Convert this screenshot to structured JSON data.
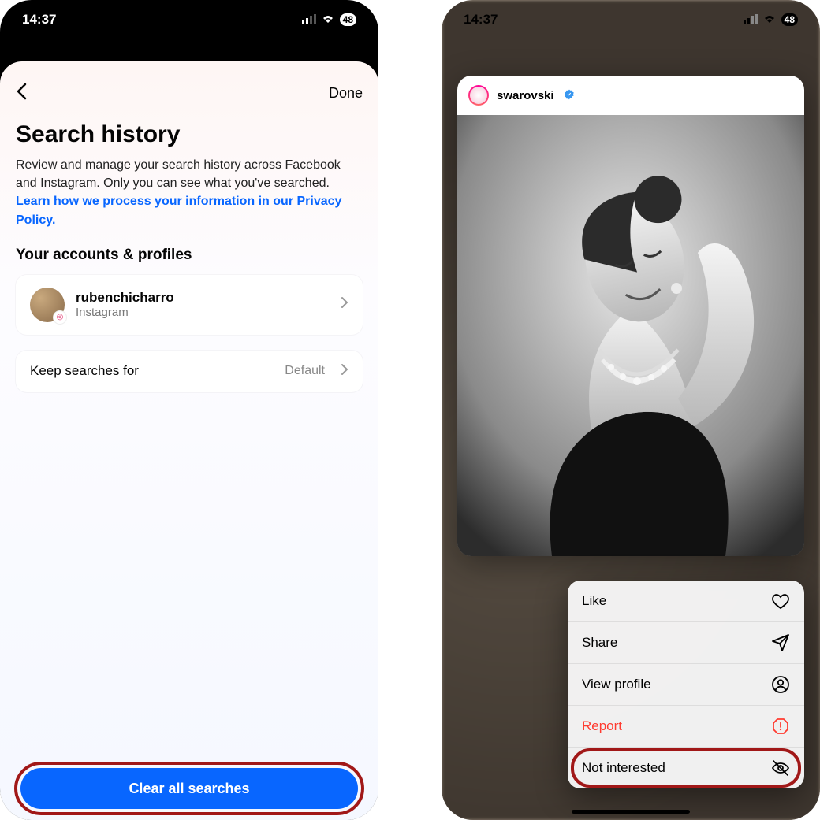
{
  "status": {
    "time": "14:37",
    "battery": "48"
  },
  "left": {
    "done": "Done",
    "title": "Search history",
    "desc_prefix": "Review and manage your search history across Facebook and Instagram. Only you can see what you've searched. ",
    "desc_link": "Learn how we process your information in our Privacy Policy.",
    "section": "Your accounts & profiles",
    "account": {
      "name": "rubenchicharro",
      "platform": "Instagram"
    },
    "keep_label": "Keep searches for",
    "keep_value": "Default",
    "clear": "Clear all searches"
  },
  "right": {
    "post_user": "swarovski",
    "menu": {
      "like": "Like",
      "share": "Share",
      "view_profile": "View profile",
      "report": "Report",
      "not_interested": "Not interested"
    }
  }
}
